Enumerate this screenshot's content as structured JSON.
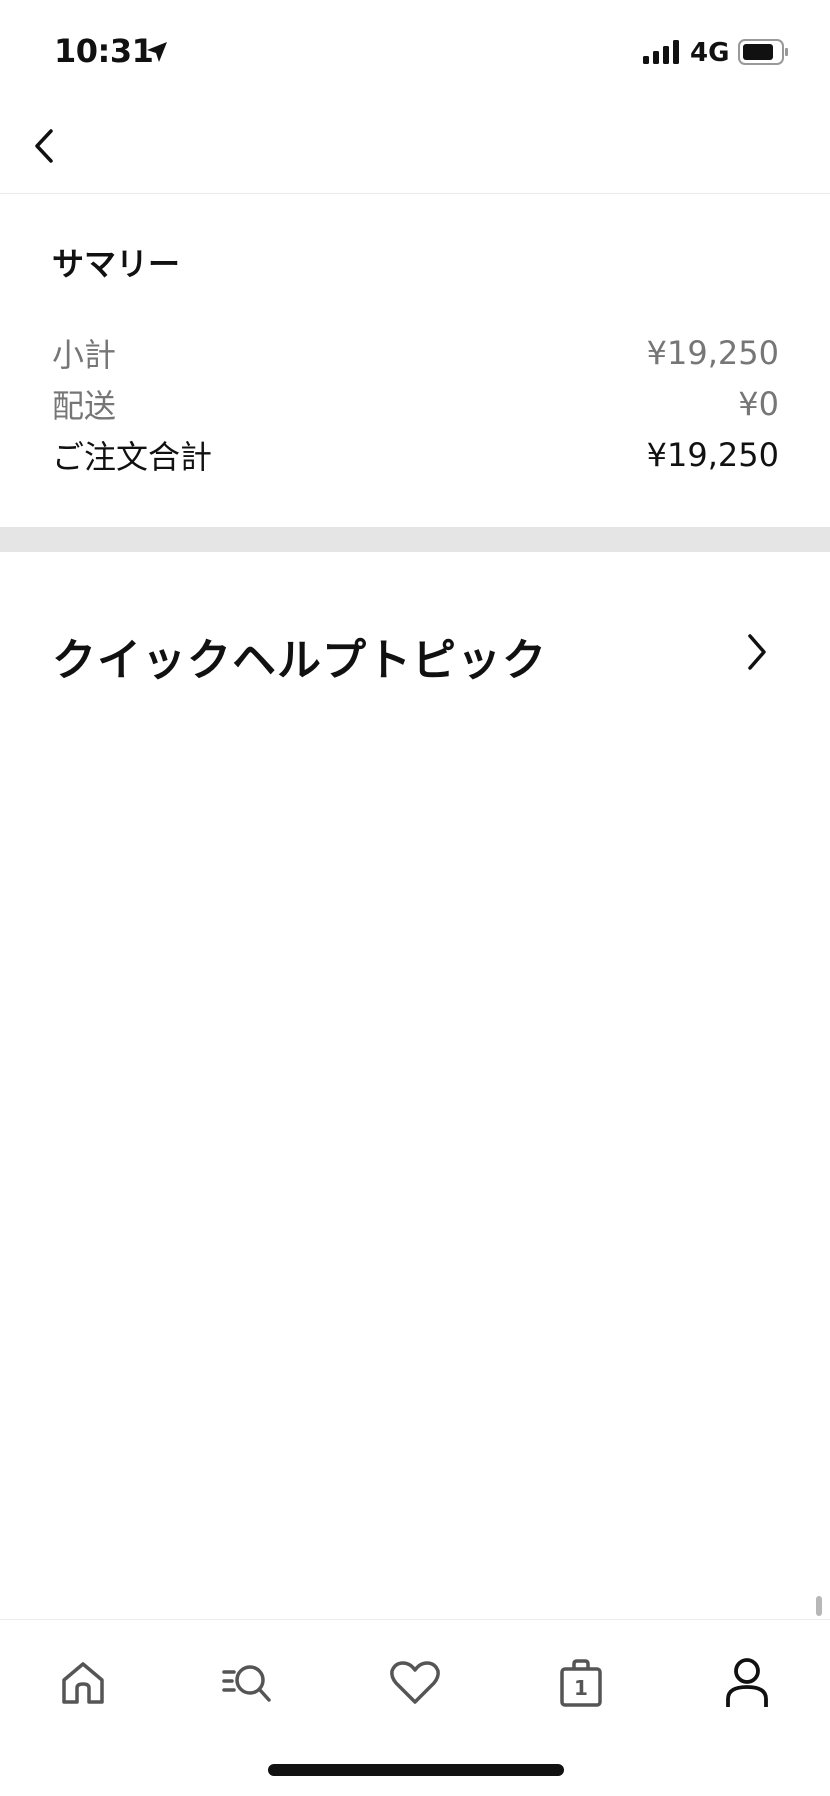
{
  "status_bar": {
    "time": "10:31",
    "network": "4G",
    "icons": [
      "location-arrow-icon",
      "signal-bars-icon",
      "battery-icon"
    ]
  },
  "nav": {
    "back_icon": "chevron-left-icon"
  },
  "summary": {
    "title": "サマリー",
    "rows": [
      {
        "label": "小計",
        "value": "¥19,250"
      },
      {
        "label": "配送",
        "value": "¥0"
      },
      {
        "label": "ご注文合計",
        "value": "¥19,250"
      }
    ]
  },
  "quick_help": {
    "label": "クイックヘルプトピック",
    "icon": "chevron-right-icon"
  },
  "tab_bar": {
    "tabs": [
      {
        "name": "home",
        "icon": "home-icon"
      },
      {
        "name": "search",
        "icon": "search-icon"
      },
      {
        "name": "favorites",
        "icon": "heart-icon"
      },
      {
        "name": "bag",
        "icon": "bag-icon",
        "badge": "1"
      },
      {
        "name": "profile",
        "icon": "profile-icon",
        "active": true
      }
    ]
  },
  "colors": {
    "text": "#111111",
    "muted": "#767676",
    "divider": "#e5e5e5",
    "icon_inactive": "#555555"
  }
}
